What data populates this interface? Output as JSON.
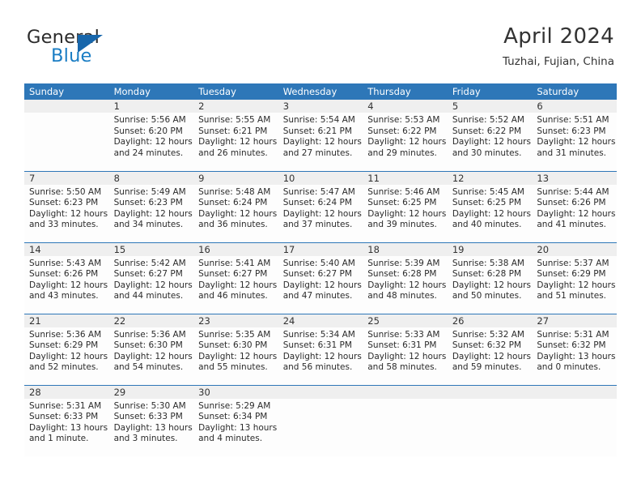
{
  "brand": {
    "name_top": "General",
    "name_bottom": "Blue",
    "logo_icon": "triangle-logo-icon",
    "accent_color": "#1766ab",
    "blue_text_color": "#1a7dc4"
  },
  "header": {
    "month_title": "April 2024",
    "location": "Tuzhai, Fujian, China"
  },
  "theme": {
    "header_row_bg": "#2e77b8",
    "daynum_band_bg": "#efefef",
    "row_divider": "#2e77b8",
    "cell_bg": "#fdfdfd",
    "text_color": "#2b2b2b"
  },
  "calendar": {
    "day_names": [
      "Sunday",
      "Monday",
      "Tuesday",
      "Wednesday",
      "Thursday",
      "Friday",
      "Saturday"
    ],
    "weeks": [
      [
        {
          "day": "",
          "empty": true,
          "sunrise": "",
          "sunset": "",
          "daylight1": "",
          "daylight2": ""
        },
        {
          "day": "1",
          "empty": false,
          "sunrise": "Sunrise: 5:56 AM",
          "sunset": "Sunset: 6:20 PM",
          "daylight1": "Daylight: 12 hours",
          "daylight2": "and 24 minutes."
        },
        {
          "day": "2",
          "empty": false,
          "sunrise": "Sunrise: 5:55 AM",
          "sunset": "Sunset: 6:21 PM",
          "daylight1": "Daylight: 12 hours",
          "daylight2": "and 26 minutes."
        },
        {
          "day": "3",
          "empty": false,
          "sunrise": "Sunrise: 5:54 AM",
          "sunset": "Sunset: 6:21 PM",
          "daylight1": "Daylight: 12 hours",
          "daylight2": "and 27 minutes."
        },
        {
          "day": "4",
          "empty": false,
          "sunrise": "Sunrise: 5:53 AM",
          "sunset": "Sunset: 6:22 PM",
          "daylight1": "Daylight: 12 hours",
          "daylight2": "and 29 minutes."
        },
        {
          "day": "5",
          "empty": false,
          "sunrise": "Sunrise: 5:52 AM",
          "sunset": "Sunset: 6:22 PM",
          "daylight1": "Daylight: 12 hours",
          "daylight2": "and 30 minutes."
        },
        {
          "day": "6",
          "empty": false,
          "sunrise": "Sunrise: 5:51 AM",
          "sunset": "Sunset: 6:23 PM",
          "daylight1": "Daylight: 12 hours",
          "daylight2": "and 31 minutes."
        }
      ],
      [
        {
          "day": "7",
          "empty": false,
          "sunrise": "Sunrise: 5:50 AM",
          "sunset": "Sunset: 6:23 PM",
          "daylight1": "Daylight: 12 hours",
          "daylight2": "and 33 minutes."
        },
        {
          "day": "8",
          "empty": false,
          "sunrise": "Sunrise: 5:49 AM",
          "sunset": "Sunset: 6:23 PM",
          "daylight1": "Daylight: 12 hours",
          "daylight2": "and 34 minutes."
        },
        {
          "day": "9",
          "empty": false,
          "sunrise": "Sunrise: 5:48 AM",
          "sunset": "Sunset: 6:24 PM",
          "daylight1": "Daylight: 12 hours",
          "daylight2": "and 36 minutes."
        },
        {
          "day": "10",
          "empty": false,
          "sunrise": "Sunrise: 5:47 AM",
          "sunset": "Sunset: 6:24 PM",
          "daylight1": "Daylight: 12 hours",
          "daylight2": "and 37 minutes."
        },
        {
          "day": "11",
          "empty": false,
          "sunrise": "Sunrise: 5:46 AM",
          "sunset": "Sunset: 6:25 PM",
          "daylight1": "Daylight: 12 hours",
          "daylight2": "and 39 minutes."
        },
        {
          "day": "12",
          "empty": false,
          "sunrise": "Sunrise: 5:45 AM",
          "sunset": "Sunset: 6:25 PM",
          "daylight1": "Daylight: 12 hours",
          "daylight2": "and 40 minutes."
        },
        {
          "day": "13",
          "empty": false,
          "sunrise": "Sunrise: 5:44 AM",
          "sunset": "Sunset: 6:26 PM",
          "daylight1": "Daylight: 12 hours",
          "daylight2": "and 41 minutes."
        }
      ],
      [
        {
          "day": "14",
          "empty": false,
          "sunrise": "Sunrise: 5:43 AM",
          "sunset": "Sunset: 6:26 PM",
          "daylight1": "Daylight: 12 hours",
          "daylight2": "and 43 minutes."
        },
        {
          "day": "15",
          "empty": false,
          "sunrise": "Sunrise: 5:42 AM",
          "sunset": "Sunset: 6:27 PM",
          "daylight1": "Daylight: 12 hours",
          "daylight2": "and 44 minutes."
        },
        {
          "day": "16",
          "empty": false,
          "sunrise": "Sunrise: 5:41 AM",
          "sunset": "Sunset: 6:27 PM",
          "daylight1": "Daylight: 12 hours",
          "daylight2": "and 46 minutes."
        },
        {
          "day": "17",
          "empty": false,
          "sunrise": "Sunrise: 5:40 AM",
          "sunset": "Sunset: 6:27 PM",
          "daylight1": "Daylight: 12 hours",
          "daylight2": "and 47 minutes."
        },
        {
          "day": "18",
          "empty": false,
          "sunrise": "Sunrise: 5:39 AM",
          "sunset": "Sunset: 6:28 PM",
          "daylight1": "Daylight: 12 hours",
          "daylight2": "and 48 minutes."
        },
        {
          "day": "19",
          "empty": false,
          "sunrise": "Sunrise: 5:38 AM",
          "sunset": "Sunset: 6:28 PM",
          "daylight1": "Daylight: 12 hours",
          "daylight2": "and 50 minutes."
        },
        {
          "day": "20",
          "empty": false,
          "sunrise": "Sunrise: 5:37 AM",
          "sunset": "Sunset: 6:29 PM",
          "daylight1": "Daylight: 12 hours",
          "daylight2": "and 51 minutes."
        }
      ],
      [
        {
          "day": "21",
          "empty": false,
          "sunrise": "Sunrise: 5:36 AM",
          "sunset": "Sunset: 6:29 PM",
          "daylight1": "Daylight: 12 hours",
          "daylight2": "and 52 minutes."
        },
        {
          "day": "22",
          "empty": false,
          "sunrise": "Sunrise: 5:36 AM",
          "sunset": "Sunset: 6:30 PM",
          "daylight1": "Daylight: 12 hours",
          "daylight2": "and 54 minutes."
        },
        {
          "day": "23",
          "empty": false,
          "sunrise": "Sunrise: 5:35 AM",
          "sunset": "Sunset: 6:30 PM",
          "daylight1": "Daylight: 12 hours",
          "daylight2": "and 55 minutes."
        },
        {
          "day": "24",
          "empty": false,
          "sunrise": "Sunrise: 5:34 AM",
          "sunset": "Sunset: 6:31 PM",
          "daylight1": "Daylight: 12 hours",
          "daylight2": "and 56 minutes."
        },
        {
          "day": "25",
          "empty": false,
          "sunrise": "Sunrise: 5:33 AM",
          "sunset": "Sunset: 6:31 PM",
          "daylight1": "Daylight: 12 hours",
          "daylight2": "and 58 minutes."
        },
        {
          "day": "26",
          "empty": false,
          "sunrise": "Sunrise: 5:32 AM",
          "sunset": "Sunset: 6:32 PM",
          "daylight1": "Daylight: 12 hours",
          "daylight2": "and 59 minutes."
        },
        {
          "day": "27",
          "empty": false,
          "sunrise": "Sunrise: 5:31 AM",
          "sunset": "Sunset: 6:32 PM",
          "daylight1": "Daylight: 13 hours",
          "daylight2": "and 0 minutes."
        }
      ],
      [
        {
          "day": "28",
          "empty": false,
          "sunrise": "Sunrise: 5:31 AM",
          "sunset": "Sunset: 6:33 PM",
          "daylight1": "Daylight: 13 hours",
          "daylight2": "and 1 minute."
        },
        {
          "day": "29",
          "empty": false,
          "sunrise": "Sunrise: 5:30 AM",
          "sunset": "Sunset: 6:33 PM",
          "daylight1": "Daylight: 13 hours",
          "daylight2": "and 3 minutes."
        },
        {
          "day": "30",
          "empty": false,
          "sunrise": "Sunrise: 5:29 AM",
          "sunset": "Sunset: 6:34 PM",
          "daylight1": "Daylight: 13 hours",
          "daylight2": "and 4 minutes."
        },
        {
          "day": "",
          "empty": true,
          "sunrise": "",
          "sunset": "",
          "daylight1": "",
          "daylight2": ""
        },
        {
          "day": "",
          "empty": true,
          "sunrise": "",
          "sunset": "",
          "daylight1": "",
          "daylight2": ""
        },
        {
          "day": "",
          "empty": true,
          "sunrise": "",
          "sunset": "",
          "daylight1": "",
          "daylight2": ""
        },
        {
          "day": "",
          "empty": true,
          "sunrise": "",
          "sunset": "",
          "daylight1": "",
          "daylight2": ""
        }
      ]
    ]
  }
}
